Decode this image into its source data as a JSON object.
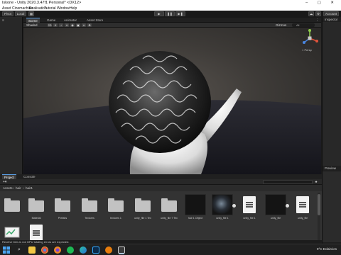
{
  "window": {
    "title": "Iskone - Unity 2020.3.47f1 Personal* <DX12>",
    "controls": "–  ▢  ✕"
  },
  "menu": [
    "Asset",
    "Cinemachine",
    "Realisation",
    "Tutorial",
    "Window",
    "Help"
  ],
  "toolbar": {
    "left_buttons": [
      "Pivot",
      "Local"
    ],
    "right_buttons": [
      "Account"
    ]
  },
  "scene_tabs": [
    {
      "label": "Scene",
      "active": true
    },
    {
      "label": "Game",
      "active": false
    },
    {
      "label": "Animator",
      "active": false
    },
    {
      "label": "Asset Store",
      "active": false
    }
  ],
  "scene_view": {
    "shading_mode": "Shaded",
    "toggle_2d": "2D",
    "gizmos_label": "Gizmos",
    "search": "All",
    "projection": "< Persp"
  },
  "inspector": {
    "title": "Inspector"
  },
  "preview": {
    "title": "Preview"
  },
  "project": {
    "tabs": [
      "Project",
      "Console"
    ],
    "breadcrumb": [
      "Assets",
      "hair",
      "hair1"
    ],
    "items": [
      {
        "name": "",
        "kind": "folder"
      },
      {
        "name": "Material",
        "kind": "folder"
      },
      {
        "name": "Prefabs",
        "kind": "folder"
      },
      {
        "name": "Textures",
        "kind": "folder"
      },
      {
        "name": "textures 1",
        "kind": "folder"
      },
      {
        "name": "unity_file 1 Tex",
        "kind": "folder"
      },
      {
        "name": "unity_file 7 Tex",
        "kind": "folder"
      },
      {
        "name": "hair 1 Object",
        "kind": "model"
      },
      {
        "name": "unity_file 1",
        "kind": "model"
      },
      {
        "name": "unity_file 1",
        "kind": "doc"
      },
      {
        "name": "unity_file",
        "kind": "model"
      },
      {
        "name": "unity_file",
        "kind": "doc"
      },
      {
        "name": "",
        "kind": "prefab"
      },
      {
        "name": "",
        "kind": "doc"
      }
    ]
  },
  "status": {
    "message": "Receive tiers is not GPU totaling errors are expected."
  },
  "taskbar": {
    "weather": "9°C  Eclaircies",
    "clock": "",
    "icons": [
      "start-icon",
      "search-icon",
      "explorer-icon",
      "chrome-icon",
      "firefox-icon",
      "spotify-icon",
      "edge-icon",
      "photoshop-icon",
      "blender-icon",
      "unity-icon"
    ]
  },
  "colors": {
    "accent": "#5a9fe6",
    "panel_bg": "#282828",
    "viewport_bg": "#3e3b38"
  }
}
